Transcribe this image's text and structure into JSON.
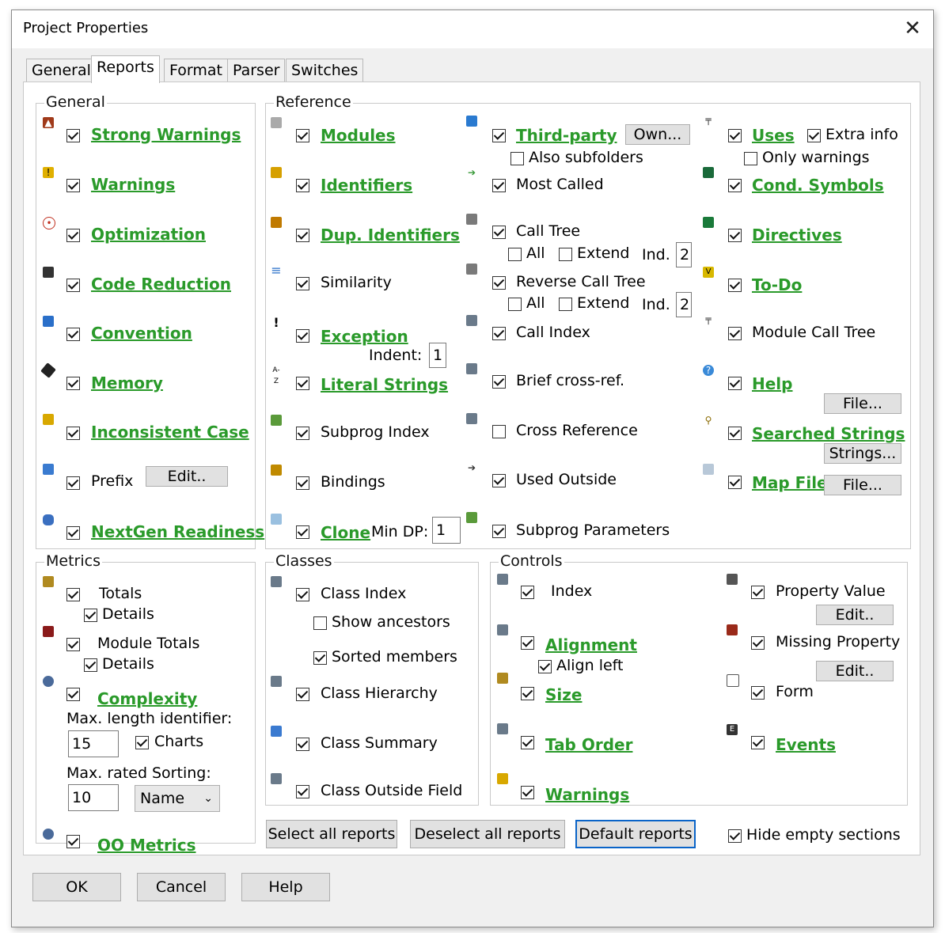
{
  "window": {
    "title": "Project Properties",
    "close": "✕"
  },
  "tabs": [
    "General",
    "Reports",
    "Format",
    "Parser",
    "Switches"
  ],
  "general": {
    "title": "General",
    "items": [
      "Strong Warnings",
      "Warnings",
      "Optimization",
      "Code Reduction",
      "Convention",
      "Memory",
      "Inconsistent Case",
      "Prefix",
      "NextGen Readiness"
    ],
    "prefix_button": "Edit.."
  },
  "reference": {
    "title": "Reference",
    "col1": [
      "Modules",
      "Identifiers",
      "Dup. Identifiers",
      "Similarity",
      "Exception",
      "Literal Strings",
      "Subprog Index",
      "Bindings",
      "Clone"
    ],
    "indent_label": "Indent:",
    "indent_value": "1",
    "min_dp_label": "Min DP:",
    "min_dp_value": "1",
    "col2": [
      "Third-party",
      "Most Called",
      "Call Tree",
      "Reverse Call Tree",
      "Call Index",
      "Brief cross-ref.",
      "Cross Reference",
      "Used Outside",
      "Subprog Parameters"
    ],
    "own_button": "Own...",
    "also_subfolders": "Also subfolders",
    "all": "All",
    "extend": "Extend",
    "ind": "Ind.",
    "ind_value": "2",
    "col3": [
      "Uses",
      "Cond. Symbols",
      "Directives",
      "To-Do",
      "Module Call Tree",
      "Help",
      "Searched Strings",
      "Map File"
    ],
    "extra_info": "Extra info",
    "only_warnings": "Only warnings",
    "file_button": "File...",
    "strings_button": "Strings..."
  },
  "metrics": {
    "title": "Metrics",
    "totals": "Totals",
    "details": "Details",
    "module_totals": "Module Totals",
    "complexity": "Complexity",
    "max_len": "Max. length identifier:",
    "max_len_value": "15",
    "charts": "Charts",
    "max_rated": "Max. rated",
    "sorting": "Sorting:",
    "max_rated_value": "10",
    "sorting_value": "Name",
    "oo_metrics": "OO Metrics"
  },
  "classes": {
    "title": "Classes",
    "class_index": "Class Index",
    "show_ancestors": "Show ancestors",
    "sorted_members": "Sorted members",
    "class_hierarchy": "Class Hierarchy",
    "class_summary": "Class Summary",
    "class_outside_field": "Class Outside Field"
  },
  "controls": {
    "title": "Controls",
    "index": "Index",
    "alignment": "Alignment",
    "align_left": "Align left",
    "size": "Size",
    "tab_order": "Tab Order",
    "warnings": "Warnings",
    "property_value": "Property Value",
    "missing_property": "Missing Property",
    "form": "Form",
    "events": "Events",
    "edit_button": "Edit.."
  },
  "actions": {
    "select_all": "Select all reports",
    "deselect_all": "Deselect all reports",
    "default": "Default reports",
    "hide_empty": "Hide empty sections"
  },
  "footer": {
    "ok": "OK",
    "cancel": "Cancel",
    "help": "Help"
  },
  "colors": {
    "link_green": "#2a9a2a",
    "focus_blue": "#0a64c8"
  }
}
